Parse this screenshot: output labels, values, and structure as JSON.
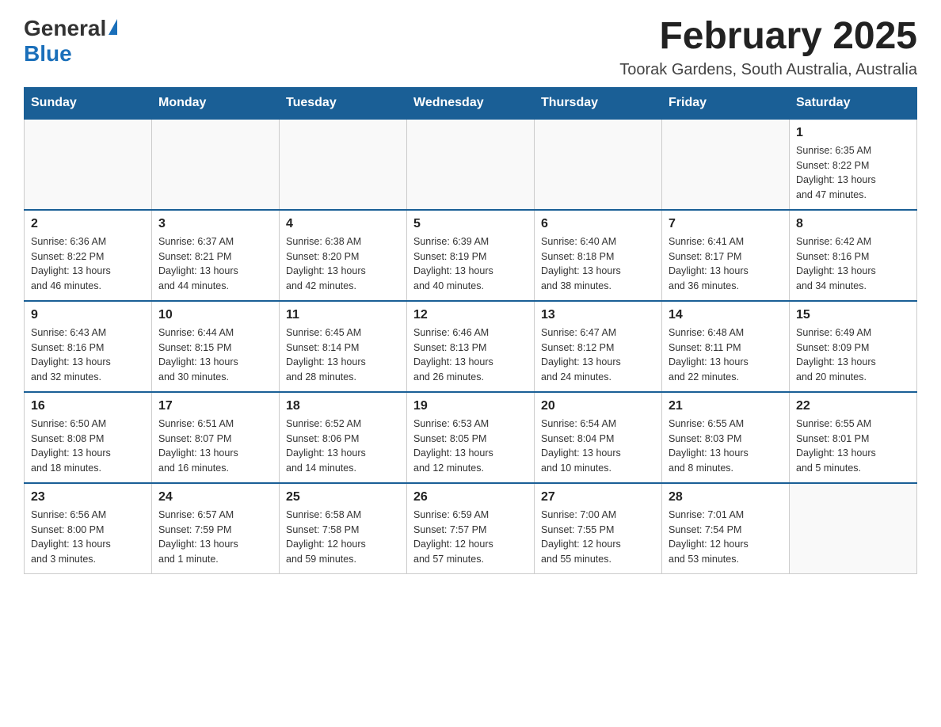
{
  "logo": {
    "general": "General",
    "blue": "Blue"
  },
  "header": {
    "month_title": "February 2025",
    "location": "Toorak Gardens, South Australia, Australia"
  },
  "weekdays": [
    "Sunday",
    "Monday",
    "Tuesday",
    "Wednesday",
    "Thursday",
    "Friday",
    "Saturday"
  ],
  "weeks": [
    [
      {
        "day": "",
        "info": ""
      },
      {
        "day": "",
        "info": ""
      },
      {
        "day": "",
        "info": ""
      },
      {
        "day": "",
        "info": ""
      },
      {
        "day": "",
        "info": ""
      },
      {
        "day": "",
        "info": ""
      },
      {
        "day": "1",
        "info": "Sunrise: 6:35 AM\nSunset: 8:22 PM\nDaylight: 13 hours\nand 47 minutes."
      }
    ],
    [
      {
        "day": "2",
        "info": "Sunrise: 6:36 AM\nSunset: 8:22 PM\nDaylight: 13 hours\nand 46 minutes."
      },
      {
        "day": "3",
        "info": "Sunrise: 6:37 AM\nSunset: 8:21 PM\nDaylight: 13 hours\nand 44 minutes."
      },
      {
        "day": "4",
        "info": "Sunrise: 6:38 AM\nSunset: 8:20 PM\nDaylight: 13 hours\nand 42 minutes."
      },
      {
        "day": "5",
        "info": "Sunrise: 6:39 AM\nSunset: 8:19 PM\nDaylight: 13 hours\nand 40 minutes."
      },
      {
        "day": "6",
        "info": "Sunrise: 6:40 AM\nSunset: 8:18 PM\nDaylight: 13 hours\nand 38 minutes."
      },
      {
        "day": "7",
        "info": "Sunrise: 6:41 AM\nSunset: 8:17 PM\nDaylight: 13 hours\nand 36 minutes."
      },
      {
        "day": "8",
        "info": "Sunrise: 6:42 AM\nSunset: 8:16 PM\nDaylight: 13 hours\nand 34 minutes."
      }
    ],
    [
      {
        "day": "9",
        "info": "Sunrise: 6:43 AM\nSunset: 8:16 PM\nDaylight: 13 hours\nand 32 minutes."
      },
      {
        "day": "10",
        "info": "Sunrise: 6:44 AM\nSunset: 8:15 PM\nDaylight: 13 hours\nand 30 minutes."
      },
      {
        "day": "11",
        "info": "Sunrise: 6:45 AM\nSunset: 8:14 PM\nDaylight: 13 hours\nand 28 minutes."
      },
      {
        "day": "12",
        "info": "Sunrise: 6:46 AM\nSunset: 8:13 PM\nDaylight: 13 hours\nand 26 minutes."
      },
      {
        "day": "13",
        "info": "Sunrise: 6:47 AM\nSunset: 8:12 PM\nDaylight: 13 hours\nand 24 minutes."
      },
      {
        "day": "14",
        "info": "Sunrise: 6:48 AM\nSunset: 8:11 PM\nDaylight: 13 hours\nand 22 minutes."
      },
      {
        "day": "15",
        "info": "Sunrise: 6:49 AM\nSunset: 8:09 PM\nDaylight: 13 hours\nand 20 minutes."
      }
    ],
    [
      {
        "day": "16",
        "info": "Sunrise: 6:50 AM\nSunset: 8:08 PM\nDaylight: 13 hours\nand 18 minutes."
      },
      {
        "day": "17",
        "info": "Sunrise: 6:51 AM\nSunset: 8:07 PM\nDaylight: 13 hours\nand 16 minutes."
      },
      {
        "day": "18",
        "info": "Sunrise: 6:52 AM\nSunset: 8:06 PM\nDaylight: 13 hours\nand 14 minutes."
      },
      {
        "day": "19",
        "info": "Sunrise: 6:53 AM\nSunset: 8:05 PM\nDaylight: 13 hours\nand 12 minutes."
      },
      {
        "day": "20",
        "info": "Sunrise: 6:54 AM\nSunset: 8:04 PM\nDaylight: 13 hours\nand 10 minutes."
      },
      {
        "day": "21",
        "info": "Sunrise: 6:55 AM\nSunset: 8:03 PM\nDaylight: 13 hours\nand 8 minutes."
      },
      {
        "day": "22",
        "info": "Sunrise: 6:55 AM\nSunset: 8:01 PM\nDaylight: 13 hours\nand 5 minutes."
      }
    ],
    [
      {
        "day": "23",
        "info": "Sunrise: 6:56 AM\nSunset: 8:00 PM\nDaylight: 13 hours\nand 3 minutes."
      },
      {
        "day": "24",
        "info": "Sunrise: 6:57 AM\nSunset: 7:59 PM\nDaylight: 13 hours\nand 1 minute."
      },
      {
        "day": "25",
        "info": "Sunrise: 6:58 AM\nSunset: 7:58 PM\nDaylight: 12 hours\nand 59 minutes."
      },
      {
        "day": "26",
        "info": "Sunrise: 6:59 AM\nSunset: 7:57 PM\nDaylight: 12 hours\nand 57 minutes."
      },
      {
        "day": "27",
        "info": "Sunrise: 7:00 AM\nSunset: 7:55 PM\nDaylight: 12 hours\nand 55 minutes."
      },
      {
        "day": "28",
        "info": "Sunrise: 7:01 AM\nSunset: 7:54 PM\nDaylight: 12 hours\nand 53 minutes."
      },
      {
        "day": "",
        "info": ""
      }
    ]
  ]
}
